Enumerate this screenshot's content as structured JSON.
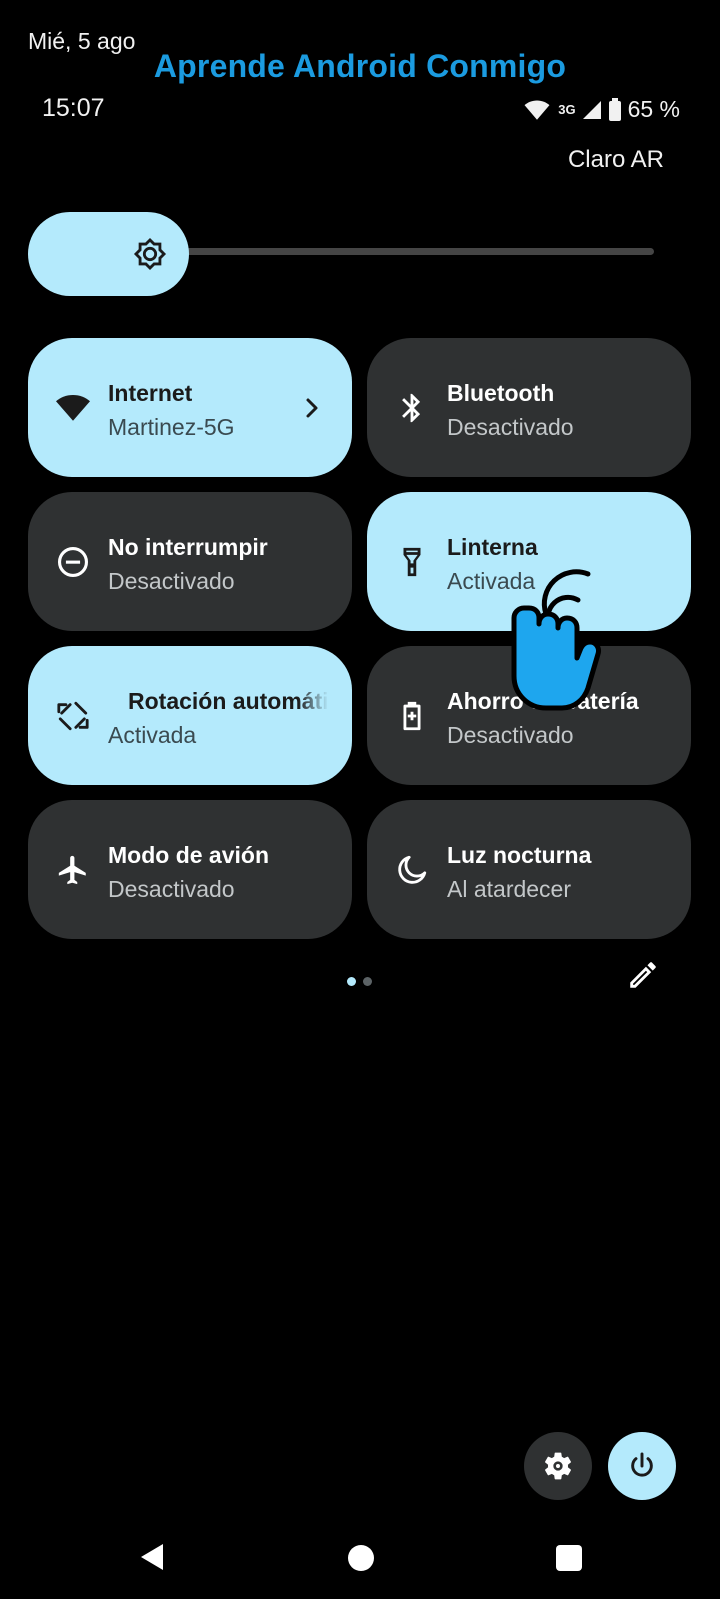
{
  "status_bar": {
    "date": "Mié, 5 ago",
    "time": "15:07",
    "network_type": "3G",
    "battery": "65 %",
    "carrier": "Claro AR"
  },
  "watermark": "Aprende Android Conmigo",
  "brightness": {
    "level": 0.23
  },
  "tiles": [
    {
      "label": "Internet",
      "sub": "Martinez-5G",
      "state": "on",
      "icon": "wifi-icon"
    },
    {
      "label": "Bluetooth",
      "sub": "Desactivado",
      "state": "off",
      "icon": "bluetooth-icon"
    },
    {
      "label": "No interrumpir",
      "sub": "Desactivado",
      "state": "off",
      "icon": "do-not-disturb-icon"
    },
    {
      "label": "Linterna",
      "sub": "Activada",
      "state": "on",
      "icon": "flashlight-icon"
    },
    {
      "label": "Rotación automática",
      "sub": "Activada",
      "state": "on",
      "icon": "auto-rotate-icon"
    },
    {
      "label": "Ahorro de batería",
      "sub": "Desactivado",
      "state": "off",
      "icon": "battery-saver-icon"
    },
    {
      "label": "Modo de avión",
      "sub": "Desactivado",
      "state": "off",
      "icon": "airplane-icon"
    },
    {
      "label": "Luz nocturna",
      "sub": "Al atardecer",
      "state": "off",
      "icon": "night-light-icon"
    }
  ],
  "pager": {
    "pages": 2,
    "current": 1
  },
  "colors": {
    "accent": "#b4eafc",
    "tile_off": "#2f3132",
    "watermark": "#1b9be0",
    "pointer_hand": "#1ea6ee"
  }
}
